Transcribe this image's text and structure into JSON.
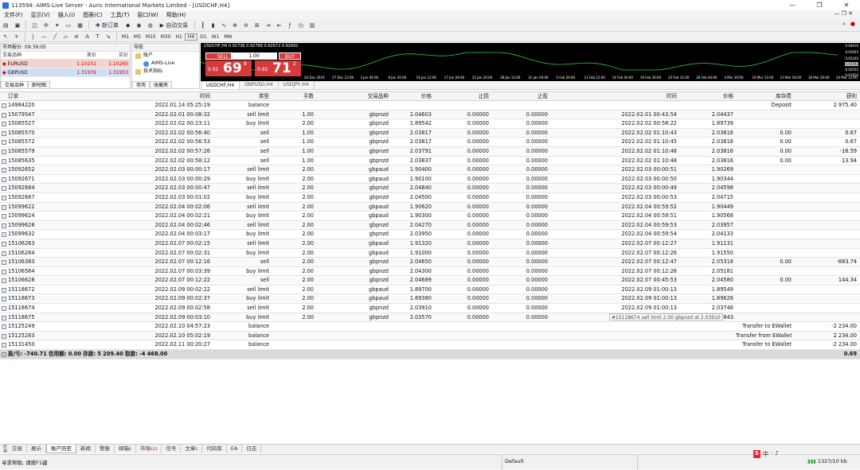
{
  "window": {
    "title": "113594: AIMS-Live Server - Auric International Markets Limited - [USDCHF,H4]",
    "minimize": "—",
    "maximize": "❐",
    "close": "✕"
  },
  "menu": [
    "文件(F)",
    "显示(V)",
    "插入(I)",
    "图表(C)",
    "工具(T)",
    "窗口(W)",
    "帮助(H)"
  ],
  "toolbar": {
    "new_order_label": "新订单",
    "auto_trading_label": "自动交易",
    "timeframes": [
      "M1",
      "M5",
      "M15",
      "M30",
      "H1",
      "H4",
      "D1",
      "W1",
      "MN"
    ]
  },
  "market_watch": {
    "title": "市场报价: 09:39:05",
    "header": {
      "symbol": "交易品种",
      "bid": "卖价",
      "ask": "买价"
    },
    "rows": [
      {
        "symbol": "EURUSD",
        "bid": "1.10251",
        "ask": "1.10265"
      },
      {
        "symbol": "GBPUSD",
        "bid": "1.31939",
        "ask": "1.31953"
      }
    ],
    "tabs": [
      "交易品种",
      "即时图"
    ]
  },
  "navigator": {
    "title": "导航",
    "items": [
      "账户",
      "AIMS-Live",
      "技术指标"
    ],
    "tabs": [
      "常用",
      "收藏夹"
    ]
  },
  "chart": {
    "title": "USDCHF,H4  0.92736 0.92768 0.92672 0.92692",
    "sell_label": "SELL",
    "buy_label": "BUY",
    "lots": "1.00",
    "sell_price_small": "0.92",
    "sell_price_big": "69",
    "sell_price_sup": "8",
    "buy_price_small": "0.92",
    "buy_price_big": "71",
    "buy_price_sup": "2",
    "price_scale": [
      "0.94610",
      "0.93925",
      "0.93240",
      "0.92692",
      "0.92555",
      "0.91870"
    ],
    "x_labels": [
      "20 Dec 2019",
      "27 Dec 12:00",
      "3 Jan 04:00",
      "8 Jan 20:00",
      "14 Jan 12:00",
      "17 Jan 04:00",
      "22 Jan 20:00",
      "28 Jan 12:00",
      "31 Jan 04:00",
      "5 Feb 20:00",
      "11 Feb 12:00",
      "14 Feb 04:00",
      "19 Feb 20:00",
      "25 Feb 12:00",
      "28 Feb 04:00",
      "4 Mar 20:00",
      "10 Mar 12:00",
      "13 Mar 04:00",
      "18 Mar 20:00",
      "24 Mar 12:00"
    ],
    "tabs": [
      "USDCHF,H4",
      "GBPUSD,H4",
      "USDJPY,H4"
    ]
  },
  "history": {
    "columns": {
      "ticket": "订单",
      "open_time": "时间",
      "type": "类型",
      "size": "手数",
      "item": "交易品种",
      "open_price": "价格",
      "sl": "止损",
      "tp": "止盈",
      "close_time": "时间",
      "close_price": "价格",
      "swap": "库存费",
      "profit": "获利"
    },
    "rows": [
      {
        "ticket": "14984220",
        "open_time": "2022.01.14 05:25:19",
        "type": "balance",
        "size": "",
        "item": "",
        "open_price": "",
        "sl": "",
        "tp": "",
        "close_time": "",
        "close_price": "",
        "swap": "Deposit",
        "profit": "2 975.40"
      },
      {
        "ticket": "15079547",
        "open_time": "2022.02.01 00:08:32",
        "type": "sell limit",
        "size": "1.00",
        "item": "gbpnzd",
        "open_price": "2.04603",
        "sl": "0.00000",
        "tp": "0.00000",
        "close_time": "2022.02.01 00:43:54",
        "close_price": "2.04437",
        "swap": "",
        "profit": ""
      },
      {
        "ticket": "15085527",
        "open_time": "2022.02.02 00:23:11",
        "type": "buy limit",
        "size": "2.00",
        "item": "gbpnzd",
        "open_price": "1.89542",
        "sl": "0.00000",
        "tp": "0.00000",
        "close_time": "2022.02.02 00:58:22",
        "close_price": "1.89739",
        "swap": "",
        "profit": ""
      },
      {
        "ticket": "15085570",
        "open_time": "2022.02.02 00:56:40",
        "type": "sell",
        "size": "1.00",
        "item": "gbpnzd",
        "open_price": "2.03817",
        "sl": "0.00000",
        "tp": "0.00000",
        "close_time": "2022.02.02 01:10:43",
        "close_price": "2.03816",
        "swap": "0.00",
        "profit": "0.67"
      },
      {
        "ticket": "15085572",
        "open_time": "2022.02.02 00:56:53",
        "type": "sell",
        "size": "1.00",
        "item": "gbpnzd",
        "open_price": "2.03817",
        "sl": "0.00000",
        "tp": "0.00000",
        "close_time": "2022.02.02 01:10:45",
        "close_price": "2.03816",
        "swap": "0.00",
        "profit": "0.67"
      },
      {
        "ticket": "15085579",
        "open_time": "2022.02.02 00:57:26",
        "type": "sell",
        "size": "1.00",
        "item": "gbpnzd",
        "open_price": "2.03791",
        "sl": "0.00000",
        "tp": "0.00000",
        "close_time": "2022.02.02 01:10:48",
        "close_price": "2.03816",
        "swap": "0.00",
        "profit": "-16.59"
      },
      {
        "ticket": "15085635",
        "open_time": "2022.02.02 00:58:12",
        "type": "sell",
        "size": "1.00",
        "item": "gbpnzd",
        "open_price": "2.03837",
        "sl": "0.00000",
        "tp": "0.00000",
        "close_time": "2022.02.02 01:10:48",
        "close_price": "2.03816",
        "swap": "0.00",
        "profit": "13.94"
      },
      {
        "ticket": "15092652",
        "open_time": "2022.02.03 00:00:17",
        "type": "sell limit",
        "size": "2.00",
        "item": "gbpaud",
        "open_price": "1.90400",
        "sl": "0.00000",
        "tp": "0.00000",
        "close_time": "2022.02.03 00:00:51",
        "close_price": "1.90269",
        "swap": "",
        "profit": ""
      },
      {
        "ticket": "15092671",
        "open_time": "2022.02.03 00:00:29",
        "type": "buy limit",
        "size": "2.00",
        "item": "gbpaud",
        "open_price": "1.90100",
        "sl": "0.00000",
        "tp": "0.00000",
        "close_time": "2022.02.03 00:00:50",
        "close_price": "1.90344",
        "swap": "",
        "profit": ""
      },
      {
        "ticket": "15092684",
        "open_time": "2022.02.03 00:00:47",
        "type": "sell limit",
        "size": "2.00",
        "item": "gbpnzd",
        "open_price": "2.04840",
        "sl": "0.00000",
        "tp": "0.00000",
        "close_time": "2022.02.03 00:00:49",
        "close_price": "2.04598",
        "swap": "",
        "profit": ""
      },
      {
        "ticket": "15092687",
        "open_time": "2022.02.03 00:01:02",
        "type": "buy limit",
        "size": "2.00",
        "item": "gbpnzd",
        "open_price": "2.04500",
        "sl": "0.00000",
        "tp": "0.00000",
        "close_time": "2022.02.03 00:00:53",
        "close_price": "2.04715",
        "swap": "",
        "profit": ""
      },
      {
        "ticket": "15099622",
        "open_time": "2022.02.04 00:02:06",
        "type": "sell limit",
        "size": "2.00",
        "item": "gbpaud",
        "open_price": "1.90620",
        "sl": "0.00000",
        "tp": "0.00000",
        "close_time": "2022.02.04 00:59:52",
        "close_price": "1.90449",
        "swap": "",
        "profit": ""
      },
      {
        "ticket": "15099624",
        "open_time": "2022.02.04 00:02:21",
        "type": "buy limit",
        "size": "2.00",
        "item": "gbpaud",
        "open_price": "1.90300",
        "sl": "0.00000",
        "tp": "0.00000",
        "close_time": "2022.02.04 00:59:51",
        "close_price": "1.90568",
        "swap": "",
        "profit": ""
      },
      {
        "ticket": "15099628",
        "open_time": "2022.02.04 00:02:46",
        "type": "sell limit",
        "size": "2.00",
        "item": "gbpnzd",
        "open_price": "2.04270",
        "sl": "0.00000",
        "tp": "0.00000",
        "close_time": "2022.02.04 00:59:53",
        "close_price": "2.03957",
        "swap": "",
        "profit": ""
      },
      {
        "ticket": "15099632",
        "open_time": "2022.02.04 00:03:17",
        "type": "buy limit",
        "size": "2.00",
        "item": "gbpnzd",
        "open_price": "2.03950",
        "sl": "0.00000",
        "tp": "0.00000",
        "close_time": "2022.02.04 00:59:54",
        "close_price": "2.04133",
        "swap": "",
        "profit": ""
      },
      {
        "ticket": "15106263",
        "open_time": "2022.02.07 00:02:15",
        "type": "sell limit",
        "size": "2.00",
        "item": "gbpaud",
        "open_price": "1.91320",
        "sl": "0.00000",
        "tp": "0.00000",
        "close_time": "2022.02.07 00:12:27",
        "close_price": "1.91131",
        "swap": "",
        "profit": ""
      },
      {
        "ticket": "15106264",
        "open_time": "2022.02.07 00:02:31",
        "type": "buy limit",
        "size": "2.00",
        "item": "gbpaud",
        "open_price": "1.91000",
        "sl": "0.00000",
        "tp": "0.00000",
        "close_time": "2022.02.07 00:12:26",
        "close_price": "1.91550",
        "swap": "",
        "profit": ""
      },
      {
        "ticket": "15106383",
        "open_time": "2022.02.07 00:12:16",
        "type": "sell",
        "size": "2.00",
        "item": "gbpnzd",
        "open_price": "2.04650",
        "sl": "0.00000",
        "tp": "0.00000",
        "close_time": "2022.02.07 00:12:47",
        "close_price": "2.05318",
        "swap": "0.00",
        "profit": "-883.74"
      },
      {
        "ticket": "15106564",
        "open_time": "2022.02.07 00:03:39",
        "type": "buy limit",
        "size": "2.00",
        "item": "gbpnzd",
        "open_price": "2.04300",
        "sl": "0.00000",
        "tp": "0.00000",
        "close_time": "2022.02.07 00:12:26",
        "close_price": "2.05181",
        "swap": "",
        "profit": ""
      },
      {
        "ticket": "15106628",
        "open_time": "2022.02.07 00:12:22",
        "type": "sell",
        "size": "2.00",
        "item": "gbpnzd",
        "open_price": "2.04689",
        "sl": "0.00000",
        "tp": "0.00000",
        "close_time": "2022.02.07 00:45:53",
        "close_price": "2.04580",
        "swap": "0.00",
        "profit": "144.34"
      },
      {
        "ticket": "15118672",
        "open_time": "2022.02.09 00:02:22",
        "type": "sell limit",
        "size": "2.00",
        "item": "gbpaud",
        "open_price": "1.89700",
        "sl": "0.00000",
        "tp": "0.00000",
        "close_time": "2022.02.09 01:00:13",
        "close_price": "1.89549",
        "swap": "",
        "profit": ""
      },
      {
        "ticket": "15118673",
        "open_time": "2022.02.09 00:02:37",
        "type": "buy limit",
        "size": "2.00",
        "item": "gbpaud",
        "open_price": "1.89380",
        "sl": "0.00000",
        "tp": "0.00000",
        "close_time": "2022.02.09 01:00:13",
        "close_price": "1.89626",
        "swap": "",
        "profit": ""
      },
      {
        "ticket": "15118674",
        "open_time": "2022.02.09 00:02:58",
        "type": "sell limit",
        "size": "2.00",
        "item": "gbpnzd",
        "open_price": "2.03910",
        "sl": "0.00000",
        "tp": "0.00000",
        "close_time": "2022.02.09 01:00:13",
        "close_price": "2.03746",
        "swap": "",
        "profit": ""
      },
      {
        "ticket": "15118675",
        "open_time": "2022.02.09 00:03:10",
        "type": "buy limit",
        "size": "2.00",
        "item": "gbpnzd",
        "open_price": "2.03570",
        "sl": "0.00000",
        "tp": "0.00000",
        "close_time": "2022.02.09 01:00:14",
        "close_price": "2.03843",
        "swap": "",
        "profit": ""
      },
      {
        "ticket": "15125249",
        "open_time": "2022.02.10 04:57:23",
        "type": "balance",
        "size": "",
        "item": "",
        "open_price": "",
        "sl": "",
        "tp": "",
        "close_time": "",
        "close_price": "",
        "swap": "Transfer to EWallet",
        "profit": "-2 234.00"
      },
      {
        "ticket": "15125283",
        "open_time": "2022.02.10 05:02:19",
        "type": "balance",
        "size": "",
        "item": "",
        "open_price": "",
        "sl": "",
        "tp": "",
        "close_time": "",
        "close_price": "",
        "swap": "Transfer from EWallet 113595",
        "profit": "2 234.00"
      },
      {
        "ticket": "15131450",
        "open_time": "2022.02.11 00:20:27",
        "type": "balance",
        "size": "",
        "item": "",
        "open_price": "",
        "sl": "",
        "tp": "",
        "close_time": "",
        "close_price": "",
        "swap": "Transfer to EWallet",
        "profit": "-2 234.00"
      }
    ],
    "footer": {
      "summary": "盈/亏: -740.71  信用额: 0.00  存款: 5 209.40  取款: -4 468.00",
      "total": "0.69"
    },
    "tooltip": "#15118674 sell limit 2.00 gbpnzd at 2.03910"
  },
  "bottom_tabs": [
    {
      "label": "交易",
      "sub": ""
    },
    {
      "label": "展示",
      "sub": ""
    },
    {
      "label": "账户历史",
      "sub": ""
    },
    {
      "label": "新闻",
      "sub": ""
    },
    {
      "label": "警报",
      "sub": ""
    },
    {
      "label": "邮箱",
      "sub": "6"
    },
    {
      "label": "市场",
      "sub": "123"
    },
    {
      "label": "信号",
      "sub": ""
    },
    {
      "label": "文章",
      "sub": "1"
    },
    {
      "label": "代码库",
      "sub": ""
    },
    {
      "label": "EA",
      "sub": ""
    },
    {
      "label": "日志",
      "sub": ""
    }
  ],
  "terminal_side_label": "终端",
  "status": {
    "help": "寻求帮助, 请按F1键",
    "profile": "Default",
    "connection": "1327/10 kb",
    "ime": [
      "S",
      "中",
      "·",
      "♪"
    ]
  }
}
